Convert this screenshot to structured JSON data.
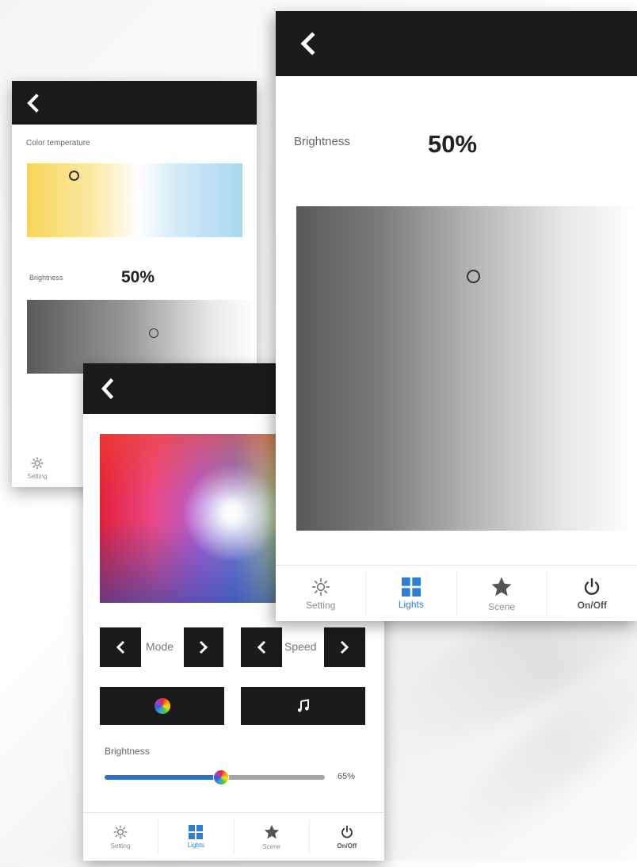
{
  "panel_left": {
    "section_color_temp": "Color temperature",
    "brightness_label": "Brightness",
    "brightness_value": "50%",
    "nav_setting": "Setting",
    "color_temp_position": 0.22,
    "brightness_position": 0.55
  },
  "panel_right": {
    "brightness_label": "Brightness",
    "brightness_value": "50%",
    "brightness_position": 0.52,
    "nav": [
      {
        "label": "Setting",
        "icon": "gear-icon"
      },
      {
        "label": "Lights",
        "icon": "grid-icon",
        "active": true
      },
      {
        "label": "Scene",
        "icon": "star-icon"
      },
      {
        "label": "On/Off",
        "icon": "power-icon"
      }
    ]
  },
  "panel_middle": {
    "mode_label": "Mode",
    "speed_label": "Speed",
    "brightness_label": "Brightness",
    "brightness_value": "65%",
    "slider_fraction": 0.53,
    "buttons": {
      "color_wheel_icon": "color-wheel-icon",
      "music_icon": "music-note-icon"
    },
    "nav": [
      {
        "label": "Setting",
        "icon": "gear-icon"
      },
      {
        "label": "Lights",
        "icon": "grid-icon",
        "active": true
      },
      {
        "label": "Scene",
        "icon": "star-icon"
      },
      {
        "label": "On/Off",
        "icon": "power-icon"
      }
    ]
  },
  "colors": {
    "topbar": "#1b1b1b",
    "accent": "#2b7fd6",
    "slider_fill": "#2b6fc5",
    "nav_label": "#8e8e8e"
  }
}
